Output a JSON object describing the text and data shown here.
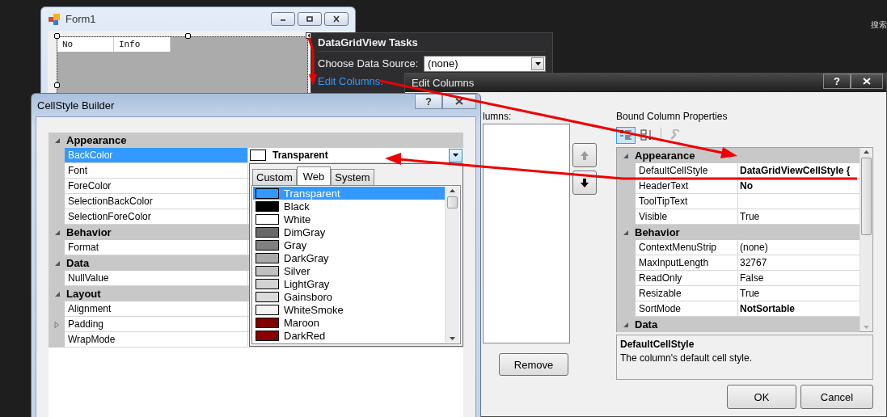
{
  "desktop": {
    "search_label": "搜索"
  },
  "form_window": {
    "title": "Form1",
    "grid_columns": [
      "No",
      "Info"
    ]
  },
  "tasks_panel": {
    "title": "DataGridView Tasks",
    "data_source_label": "Choose Data Source:",
    "data_source_value": "(none)",
    "link": "Edit Columns."
  },
  "edit_columns": {
    "title": "Edit Columns",
    "help_button": "?",
    "columns_label": "lumns:",
    "move_buttons": [
      {
        "kind": "up",
        "disabled": true
      },
      {
        "kind": "down",
        "disabled": false
      }
    ],
    "remove_button": "Remove",
    "properties_title": "Bound Column Properties",
    "toolbar": [
      {
        "kind": "categorized",
        "selected": true
      },
      {
        "kind": "alphabetical",
        "selected": false
      },
      {
        "kind": "property_pages",
        "selected": false
      }
    ],
    "properties": [
      {
        "category": "Appearance",
        "expanded": true,
        "rows": [
          {
            "name": "DefaultCellStyle",
            "value": "DataGridViewCellStyle {",
            "kind": "text",
            "bold": true,
            "selected": false
          },
          {
            "name": "HeaderText",
            "value": "No",
            "kind": "text",
            "bold": true,
            "selected": false
          },
          {
            "name": "ToolTipText",
            "kind": "text",
            "bold": false,
            "selected": false
          },
          {
            "name": "Visible",
            "value": "True",
            "kind": "text",
            "bold": false,
            "selected": false
          }
        ]
      },
      {
        "category": "Behavior",
        "expanded": true,
        "rows": [
          {
            "name": "ContextMenuStrip",
            "value": "(none)",
            "kind": "text",
            "bold": false,
            "selected": false
          },
          {
            "name": "MaxInputLength",
            "value": "32767",
            "kind": "text",
            "bold": false,
            "selected": false
          },
          {
            "name": "ReadOnly",
            "value": "False",
            "kind": "text",
            "bold": false,
            "selected": false
          },
          {
            "name": "Resizable",
            "value": "True",
            "kind": "text",
            "bold": false,
            "selected": false
          },
          {
            "name": "SortMode",
            "value": "NotSortable",
            "kind": "text",
            "bold": true,
            "selected": false
          }
        ]
      },
      {
        "category": "Data",
        "expanded": true
      }
    ],
    "description": {
      "title": "DefaultCellStyle",
      "text": "The column's default cell style."
    },
    "buttons": [
      "OK",
      "Cancel"
    ]
  },
  "cellstyle_builder": {
    "title": "CellStyle Builder",
    "help_button": "?",
    "properties": [
      {
        "category": "Appearance",
        "expanded": true,
        "rows": [
          {
            "name": "BackColor",
            "value": "Transparent",
            "kind": "color",
            "bold": true,
            "selected": true
          },
          {
            "name": "Font",
            "kind": "text",
            "bold": false,
            "selected": false
          },
          {
            "name": "ForeColor",
            "kind": "text",
            "bold": false,
            "selected": false
          },
          {
            "name": "SelectionBackColor",
            "kind": "text",
            "bold": false,
            "selected": false
          },
          {
            "name": "SelectionForeColor",
            "kind": "text",
            "bold": false,
            "selected": false
          }
        ]
      },
      {
        "category": "Behavior",
        "expanded": true,
        "rows": [
          {
            "name": "Format",
            "kind": "text",
            "bold": false,
            "selected": false
          }
        ]
      },
      {
        "category": "Data",
        "expanded": true,
        "rows": [
          {
            "name": "NullValue",
            "kind": "text",
            "bold": false,
            "selected": false
          }
        ]
      },
      {
        "category": "Layout",
        "expanded": true,
        "rows": [
          {
            "name": "Alignment",
            "kind": "text",
            "bold": false,
            "selected": false
          },
          {
            "name": "Padding",
            "kind": "expandable",
            "bold": false,
            "selected": false
          },
          {
            "name": "WrapMode",
            "kind": "text",
            "bold": false,
            "selected": false
          }
        ]
      }
    ],
    "color_picker": {
      "tabs": [
        {
          "label": "Custom",
          "selected": false
        },
        {
          "label": "Web",
          "selected": true
        },
        {
          "label": "System",
          "selected": false
        }
      ],
      "colors": [
        {
          "name": "Transparent",
          "selected": true
        },
        {
          "name": "Black",
          "color": "#000000",
          "selected": false
        },
        {
          "name": "White",
          "color": "#ffffff",
          "selected": false
        },
        {
          "name": "DimGray",
          "color": "#696969",
          "selected": false
        },
        {
          "name": "Gray",
          "color": "#808080",
          "selected": false
        },
        {
          "name": "DarkGray",
          "color": "#a9a9a9",
          "selected": false
        },
        {
          "name": "Silver",
          "color": "#c0c0c0",
          "selected": false
        },
        {
          "name": "LightGray",
          "color": "#d3d3d3",
          "selected": false
        },
        {
          "name": "Gainsboro",
          "color": "#dcdcdc",
          "selected": false
        },
        {
          "name": "WhiteSmoke",
          "color": "#f5f5f5",
          "selected": false
        },
        {
          "name": "Maroon",
          "color": "#800000",
          "selected": false
        },
        {
          "name": "DarkRed",
          "color": "#8b0000",
          "selected": false
        }
      ]
    }
  }
}
